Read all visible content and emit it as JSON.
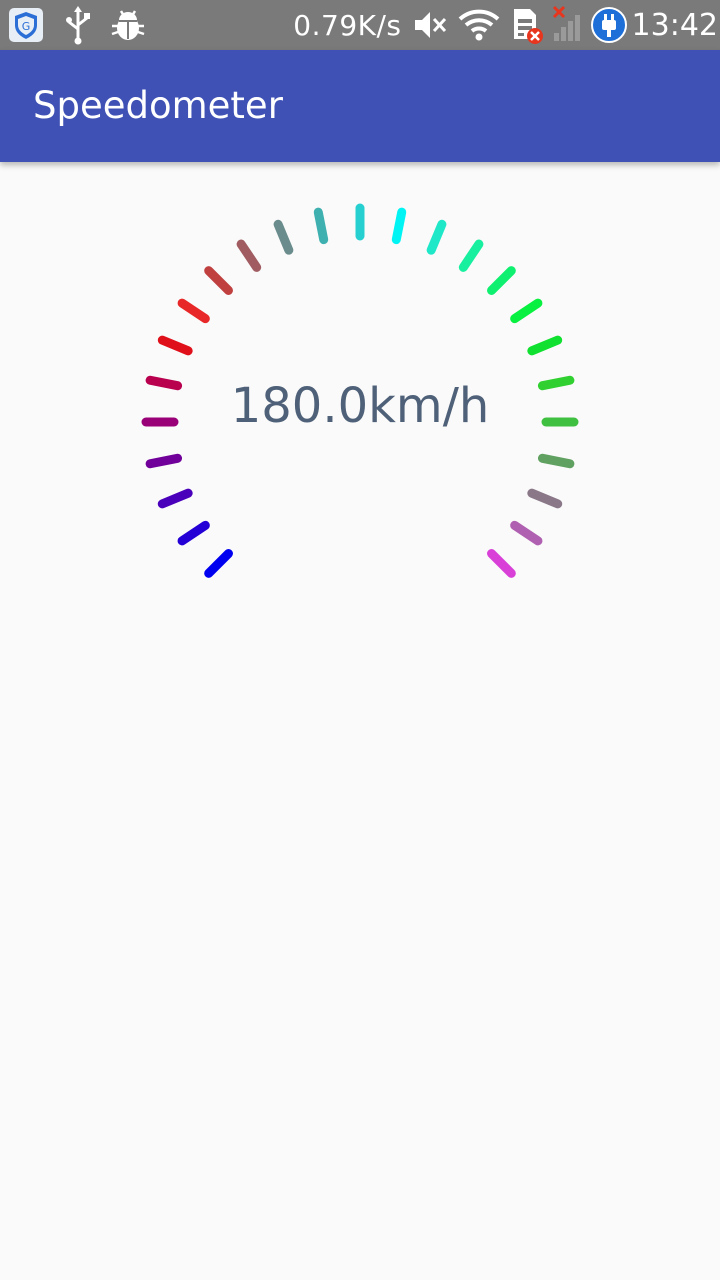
{
  "status_bar": {
    "net_speed": "0.79K/s",
    "time": "13:42",
    "icons": [
      "shield-app-icon",
      "usb-icon",
      "debug-bug-icon",
      "mute-icon",
      "wifi-icon",
      "sim-error-icon",
      "no-signal-icon",
      "power-plug-icon"
    ]
  },
  "app_bar": {
    "title": "Speedometer"
  },
  "gauge": {
    "readout": "180.0km/h",
    "value": 180.0,
    "unit": "km/h",
    "tick_count": 25,
    "sweep_degrees": 270,
    "tick_colors": [
      "#0000f0",
      "#2400d6",
      "#4a00bb",
      "#700099",
      "#990077",
      "#b8004f",
      "#e0101a",
      "#e82828",
      "#c04040",
      "#a05c60",
      "#6a8c8c",
      "#3fb0b0",
      "#26d0d0",
      "#00f4f4",
      "#1ee8c8",
      "#18f0a0",
      "#10f070",
      "#08f040",
      "#10e030",
      "#30d030",
      "#40c040",
      "#60a060",
      "#8a7888",
      "#b060b0",
      "#d840d8",
      "#f000f0"
    ],
    "readout_color": "#4f6178"
  },
  "colors": {
    "primary": "#3f51b5",
    "status_bar": "#7a7a7a",
    "background": "#fafafa"
  }
}
